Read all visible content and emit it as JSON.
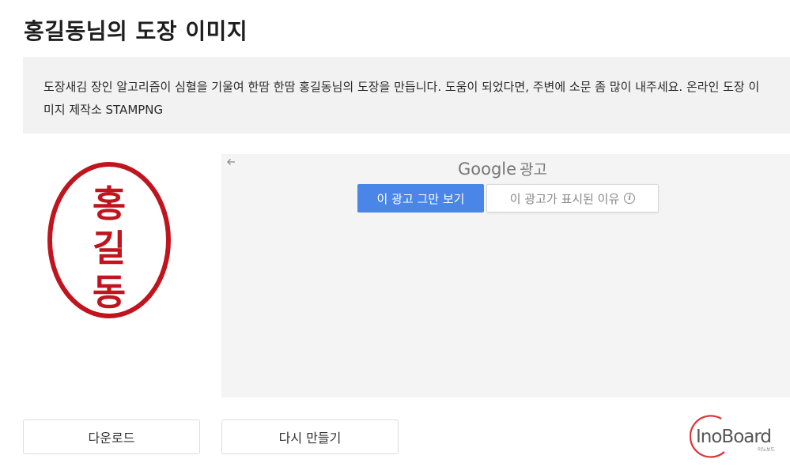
{
  "page": {
    "title": "홍길동님의 도장 이미지",
    "description": "도장새김 장인 알고리즘이 심혈을 기울여 한땀 한땀 홍길동님의 도장을 만듭니다. 도움이 되었다면, 주변에 소문 좀 많이 내주세요. 온라인 도장 이미지 제작소 STAMPNG"
  },
  "stamp": {
    "chars": [
      "홍",
      "길",
      "동"
    ],
    "color": "#c0141e"
  },
  "ad": {
    "back_icon": "back-arrow-icon",
    "brand": "Google",
    "label": "광고",
    "stop_label": "이 광고 그만 보기",
    "why_label": "이 광고가 표시된 이유",
    "info_icon": "info-icon",
    "accent": "#4a86e8"
  },
  "actions": {
    "download_label": "다운로드",
    "remake_label": "다시 만들기"
  },
  "brand_logo": {
    "name": "InoBoard",
    "sub": "이노보드",
    "accent": "#e0333a"
  }
}
